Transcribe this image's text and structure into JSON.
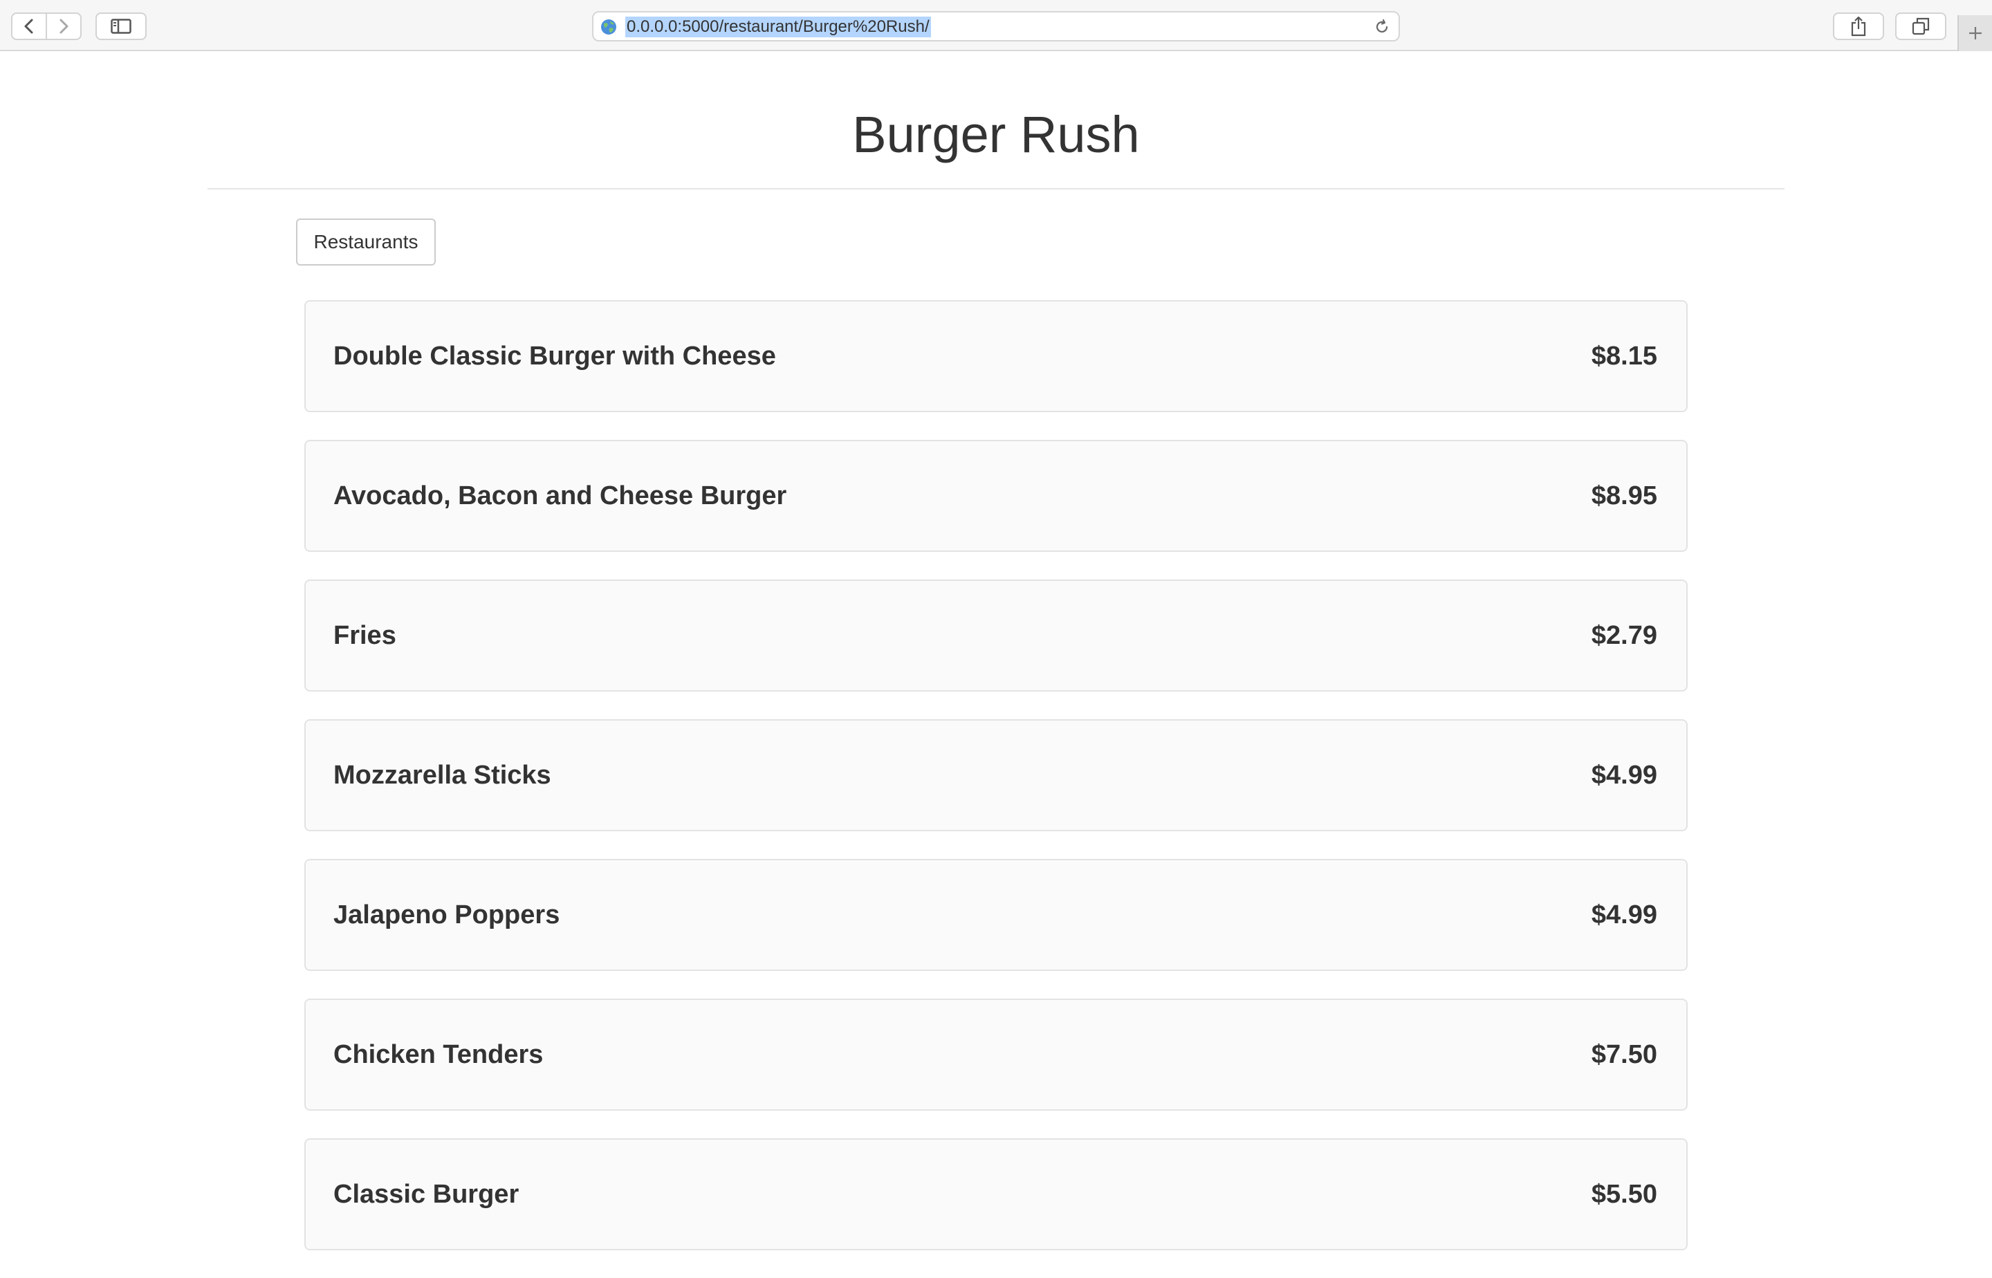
{
  "browser": {
    "url": "0.0.0.0:5000/restaurant/Burger%20Rush/",
    "icons": {
      "back": "chevron-left-icon",
      "forward": "chevron-right-icon",
      "sidebar": "sidebar-icon",
      "site": "globe-icon",
      "reload": "reload-icon",
      "share": "share-icon",
      "tabs": "tabs-overview-icon",
      "new_tab": "plus-icon"
    }
  },
  "page": {
    "title": "Burger Rush",
    "restaurants_button": "Restaurants"
  },
  "menu": {
    "items": [
      {
        "name": "Double Classic Burger with Cheese",
        "price": "$8.15"
      },
      {
        "name": "Avocado, Bacon and Cheese Burger",
        "price": "$8.95"
      },
      {
        "name": "Fries",
        "price": "$2.79"
      },
      {
        "name": "Mozzarella Sticks",
        "price": "$4.99"
      },
      {
        "name": "Jalapeno Poppers",
        "price": "$4.99"
      },
      {
        "name": "Chicken Tenders",
        "price": "$7.50"
      },
      {
        "name": "Classic Burger",
        "price": "$5.50"
      }
    ]
  },
  "colors": {
    "text": "#333333",
    "card_background": "#fafafa",
    "card_border": "#e3e3e3",
    "url_selection": "#b4d5fe"
  }
}
